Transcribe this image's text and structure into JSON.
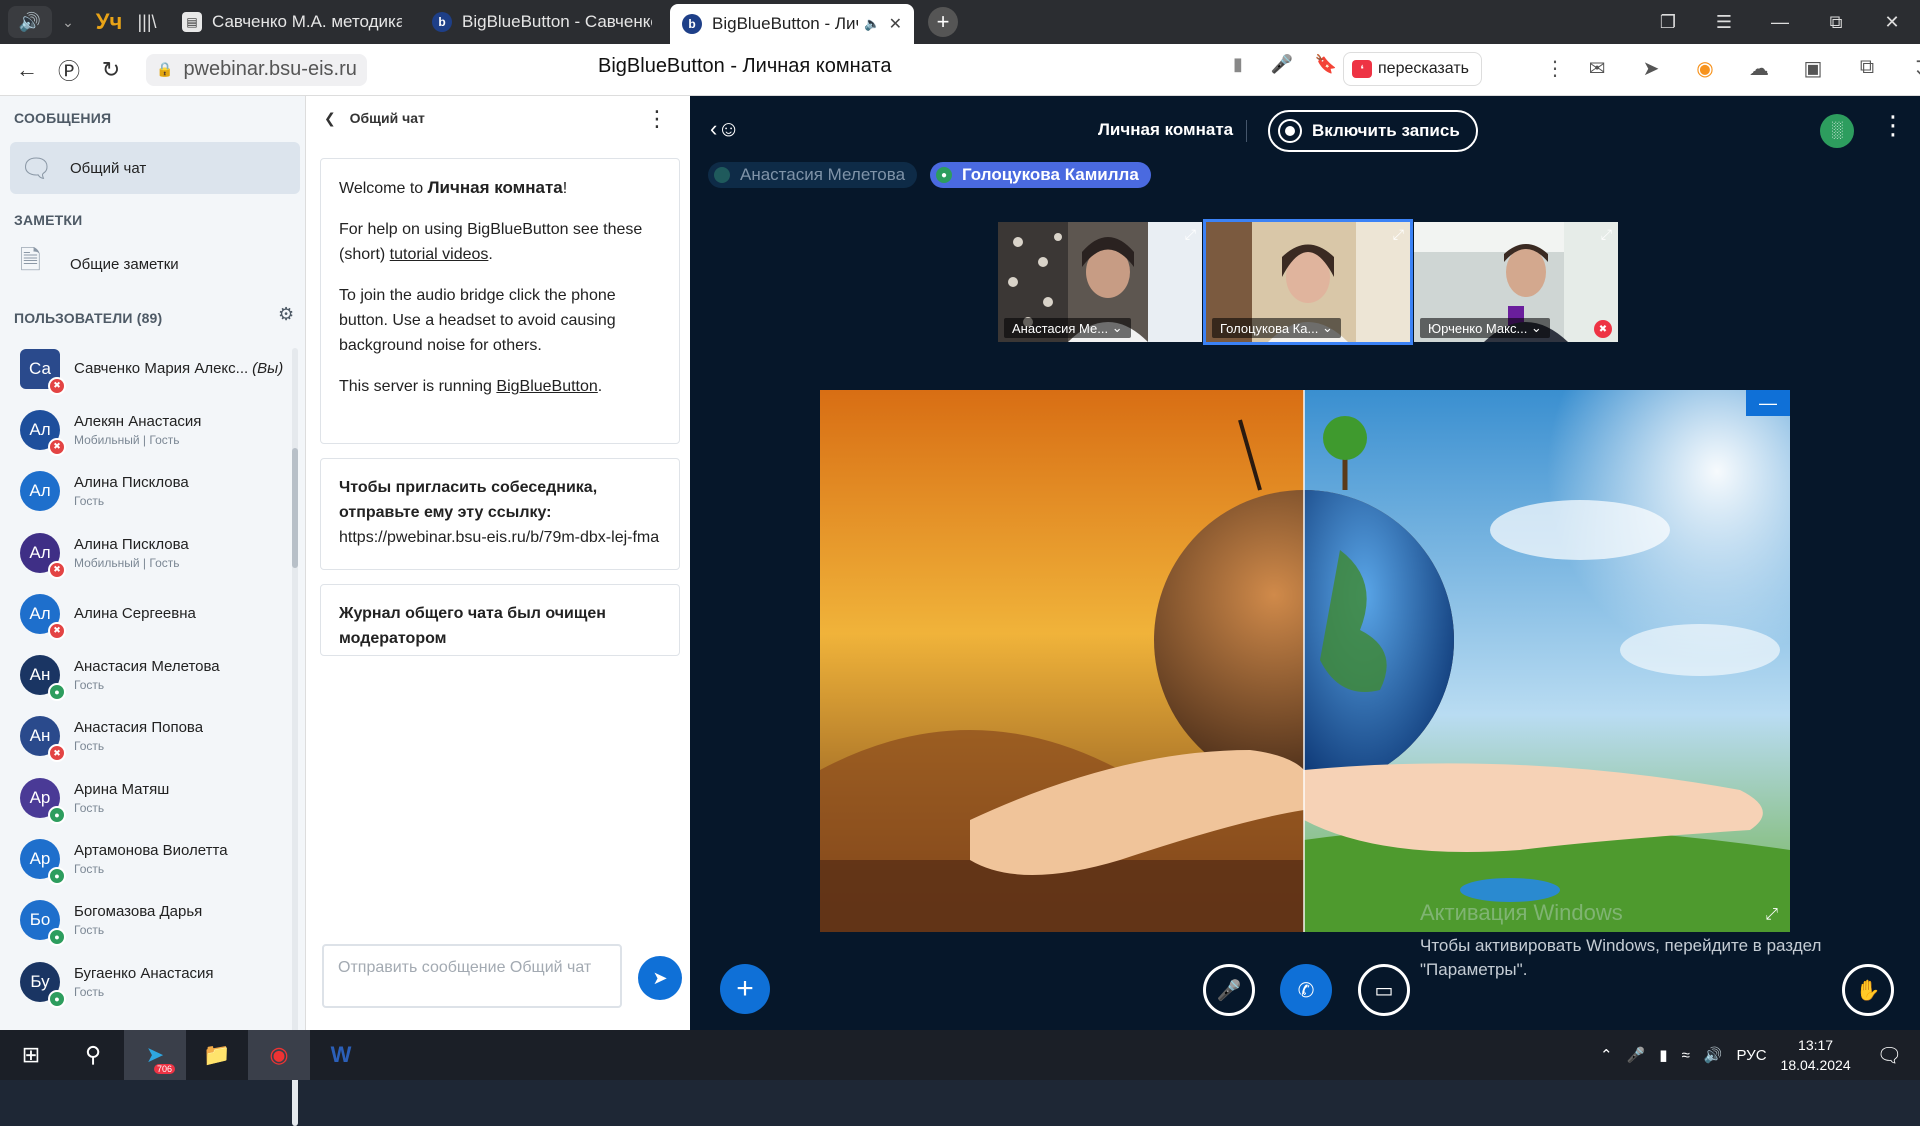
{
  "browser": {
    "pinned": [
      "Уч",
      "|||\\"
    ],
    "tabs": [
      {
        "title": "Савченко М.А. методика с",
        "favicon": "doc-icon",
        "active": false
      },
      {
        "title": "BigBlueButton - Савченко",
        "favicon": "bbb-icon",
        "active": false
      },
      {
        "title": "BigBlueButton - Личн",
        "favicon": "bbb-icon",
        "active": true
      }
    ],
    "url": "pwebinar.bsu-eis.ru",
    "page_title": "BigBlueButton - Личная комната",
    "retell_label": "пересказать"
  },
  "sidebar": {
    "messages_header": "СООБЩЕНИЯ",
    "public_chat_label": "Общий чат",
    "notes_header": "ЗАМЕТКИ",
    "shared_notes_label": "Общие заметки",
    "users_header": "ПОЛЬЗОВАТЕЛИ (89)",
    "users": [
      {
        "initials": "Са",
        "name": "Савченко Мария Алекс...",
        "you": "(Вы)",
        "role": "",
        "color": "#2a4a8c",
        "status": "muted",
        "shape": "square"
      },
      {
        "initials": "Ал",
        "name": "Алекян Анастасия",
        "role": "Мобильный | Гость",
        "color": "#1e4f9c",
        "status": "muted",
        "shape": "round"
      },
      {
        "initials": "Ал",
        "name": "Алина Писклова",
        "role": "Гость",
        "color": "#1e6fcc",
        "status": "none",
        "shape": "round"
      },
      {
        "initials": "Ал",
        "name": "Алина Писклова",
        "role": "Мобильный | Гость",
        "color": "#3f2f86",
        "status": "muted",
        "shape": "round"
      },
      {
        "initials": "Ал",
        "name": "Алина Сергеевна",
        "role": "",
        "color": "#1e6fcc",
        "status": "muted",
        "shape": "round"
      },
      {
        "initials": "Ан",
        "name": "Анастасия Мелетова",
        "role": "Гость",
        "color": "#1a3563",
        "status": "listen",
        "shape": "round"
      },
      {
        "initials": "Ан",
        "name": "Анастасия Попова",
        "role": "Гость",
        "color": "#2a4a8c",
        "status": "muted",
        "shape": "round"
      },
      {
        "initials": "Ар",
        "name": "Арина Матяш",
        "role": "Гость",
        "color": "#4a3a96",
        "status": "listen",
        "shape": "round"
      },
      {
        "initials": "Ар",
        "name": "Артамонова Виолетта",
        "role": "Гость",
        "color": "#1e6fcc",
        "status": "listen",
        "shape": "round"
      },
      {
        "initials": "Бо",
        "name": "Богомазова Дарья",
        "role": "Гость",
        "color": "#1e6fcc",
        "status": "listen",
        "shape": "round"
      },
      {
        "initials": "Бу",
        "name": "Бугаенко Анастасия",
        "role": "Гость",
        "color": "#1a3563",
        "status": "listen",
        "shape": "round"
      }
    ]
  },
  "chat": {
    "title": "Общий чат",
    "welcome_prefix": "Welcome to ",
    "welcome_room": "Личная комната",
    "welcome_suffix": "!",
    "help_prefix": "For help on using BigBlueButton see these (short) ",
    "help_link": "tutorial videos",
    "help_suffix": ".",
    "audio_text": "To join the audio bridge click the phone button. Use a headset to avoid causing background noise for others.",
    "server_prefix": "This server is running ",
    "server_link": "BigBlueButton",
    "server_suffix": ".",
    "invite_text": "Чтобы пригласить собеседника, отправьте ему эту ссылку:",
    "invite_link": "https://pwebinar.bsu-eis.ru/b/79m-dbx-lej-fma",
    "cleared_text": "Журнал общего чата был очищен модератором",
    "input_placeholder": "Отправить сообщение Общий чат"
  },
  "meeting": {
    "room_title": "Личная комната",
    "record_label": "Включить запись",
    "talkers": [
      "Анастасия Мелетова",
      "Голоцукова Камилла"
    ],
    "videos": [
      {
        "name": "Анастасия Ме...",
        "selected": false
      },
      {
        "name": "Голоцукова Ка...",
        "selected": true
      },
      {
        "name": "Юрченко Макс...",
        "selected": false
      }
    ]
  },
  "watermark": {
    "line1": "Активация Windows",
    "line2": "Чтобы активировать Windows, перейдите в раздел",
    "line3": "\"Параметры\"."
  },
  "taskbar": {
    "telegram_badge": "706",
    "lang": "РУС",
    "time": "13:17",
    "date": "18.04.2024"
  },
  "colors": {
    "accent": "#0f70d7",
    "meeting_bg": "#06172a",
    "sidebar_bg": "#f3f6f9",
    "muted": "#e34444",
    "listen": "#2d9d5e"
  }
}
